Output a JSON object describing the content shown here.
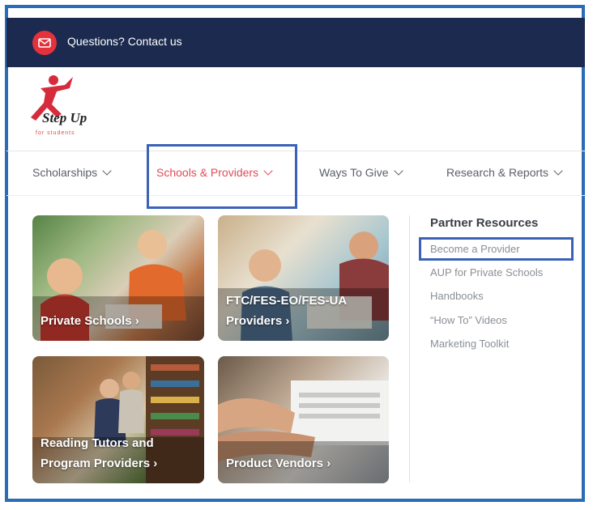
{
  "topbar": {
    "contact_text": "Questions? Contact us"
  },
  "logo": {
    "text": "Step Up",
    "subtext": "for students"
  },
  "nav": {
    "items": [
      {
        "label": "Scholarships"
      },
      {
        "label": "Schools & Providers"
      },
      {
        "label": "Ways To Give"
      },
      {
        "label": "Research & Reports"
      }
    ]
  },
  "cards": [
    {
      "label": "Private Schools ›"
    },
    {
      "label_line1": "FTC/FES-EO/FES-UA",
      "label_line2": "Providers ›"
    },
    {
      "label_line1": "Reading Tutors and",
      "label_line2": "Program Providers ›"
    },
    {
      "label": "Product Vendors ›"
    }
  ],
  "partner_resources": {
    "title": "Partner Resources",
    "links": [
      "Become a Provider",
      "AUP for Private Schools",
      "Handbooks",
      "“How To” Videos",
      "Marketing Toolkit"
    ]
  },
  "colors": {
    "topbar": "#1b2a4e",
    "accent": "#e14a57",
    "highlight_box": "#3b62b8",
    "frame": "#2b6cb8"
  }
}
